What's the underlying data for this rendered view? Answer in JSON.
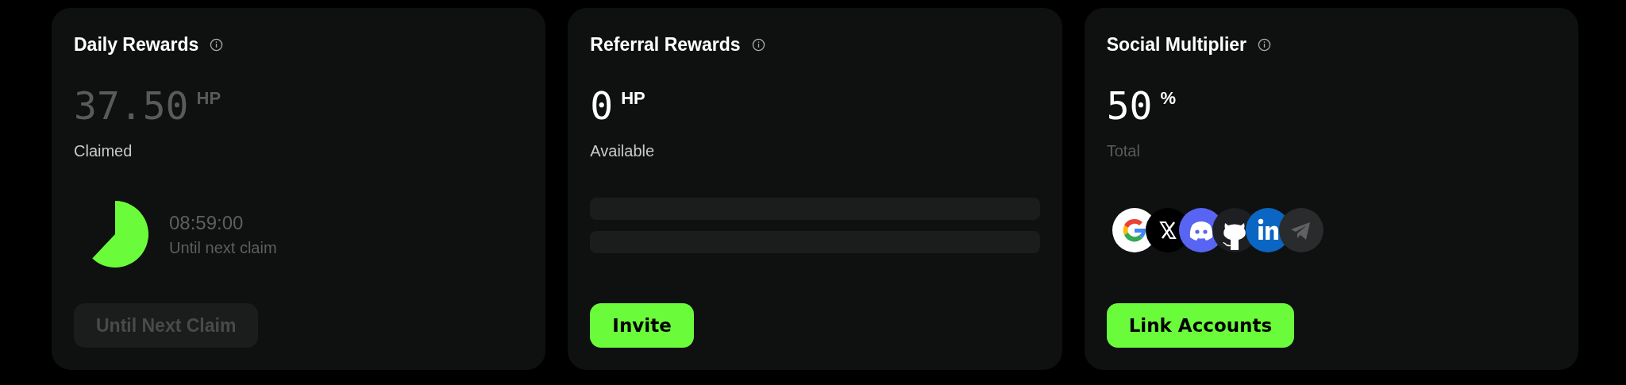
{
  "cards": [
    {
      "kind": "timer",
      "title": "Daily Rewards",
      "value": "37.50",
      "unit": "HP",
      "value_muted": true,
      "caption": "Claimed",
      "caption_muted": false,
      "timer": {
        "time": "08:59:00",
        "label": "Until next claim"
      },
      "button": {
        "label": "Until Next Claim",
        "disabled": true
      }
    },
    {
      "kind": "skeleton",
      "title": "Referral Rewards",
      "value": "0",
      "unit": "HP",
      "value_muted": false,
      "caption": "Available",
      "caption_muted": false,
      "button": {
        "label": "Invite",
        "disabled": false
      }
    },
    {
      "kind": "socials",
      "title": "Social Multiplier",
      "value": "50",
      "unit": "%",
      "value_muted": false,
      "caption": "Total",
      "caption_muted": true,
      "accounts": [
        {
          "kind": "google"
        },
        {
          "kind": "x"
        },
        {
          "kind": "discord"
        },
        {
          "kind": "github"
        },
        {
          "kind": "linkedin"
        },
        {
          "kind": "telegram"
        }
      ],
      "button": {
        "label": "Link Accounts",
        "disabled": false
      }
    }
  ]
}
